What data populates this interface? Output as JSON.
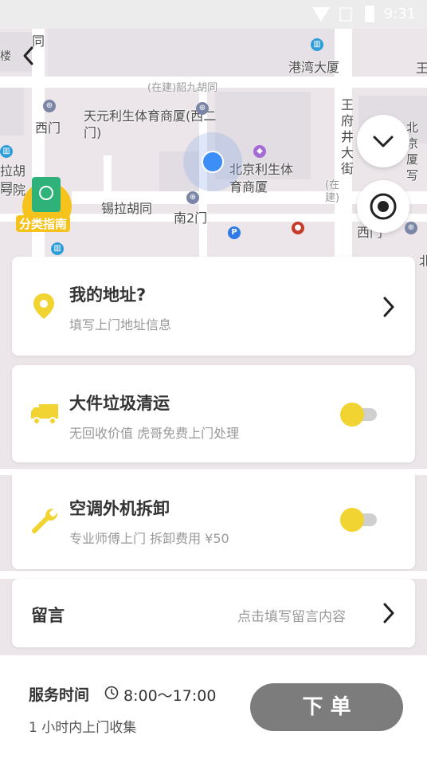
{
  "status_bar": {
    "time": "9:31"
  },
  "map": {
    "labels": {
      "hutong_top": "(在建)韶九胡同",
      "gangwan": "港湾大厦",
      "tianyuan": "天元利生体育商厦(西二门)",
      "ximen": "西门",
      "beijing_lisheng": "北京利生体育商厦",
      "wangfujing": "王府井大街",
      "xila": "锡拉胡同",
      "nan2men": "南2门",
      "zaijian_right": "(在建)",
      "xiamen_right": "西门",
      "lou": "楼",
      "tong": "同",
      "wang": "王",
      "la_hutong": "拉胡同",
      "hao_yuan": "号院",
      "bei_xia": "北京厦写",
      "bei_right": "北"
    },
    "poi_badge": "分类指南"
  },
  "address_card": {
    "title": "我的地址?",
    "subtitle": "填写上门地址信息"
  },
  "services": [
    {
      "title": "大件垃圾清运",
      "subtitle": "无回收价值 虎哥免费上门处理",
      "enabled": true
    },
    {
      "title": "空调外机拆卸",
      "subtitle": "专业师傅上门  拆卸费用 ¥50",
      "enabled": true
    }
  ],
  "message_card": {
    "title": "留言",
    "placeholder": "点击填写留言内容"
  },
  "footer": {
    "service_time_label": "服务时间",
    "service_time_value": "8:00～17:00",
    "note": "1 小时内上门收集",
    "order_button": "下  单"
  },
  "colors": {
    "accent": "#f1d332",
    "location_dot": "#3e8ef7",
    "order_button": "#7c7c7c"
  }
}
